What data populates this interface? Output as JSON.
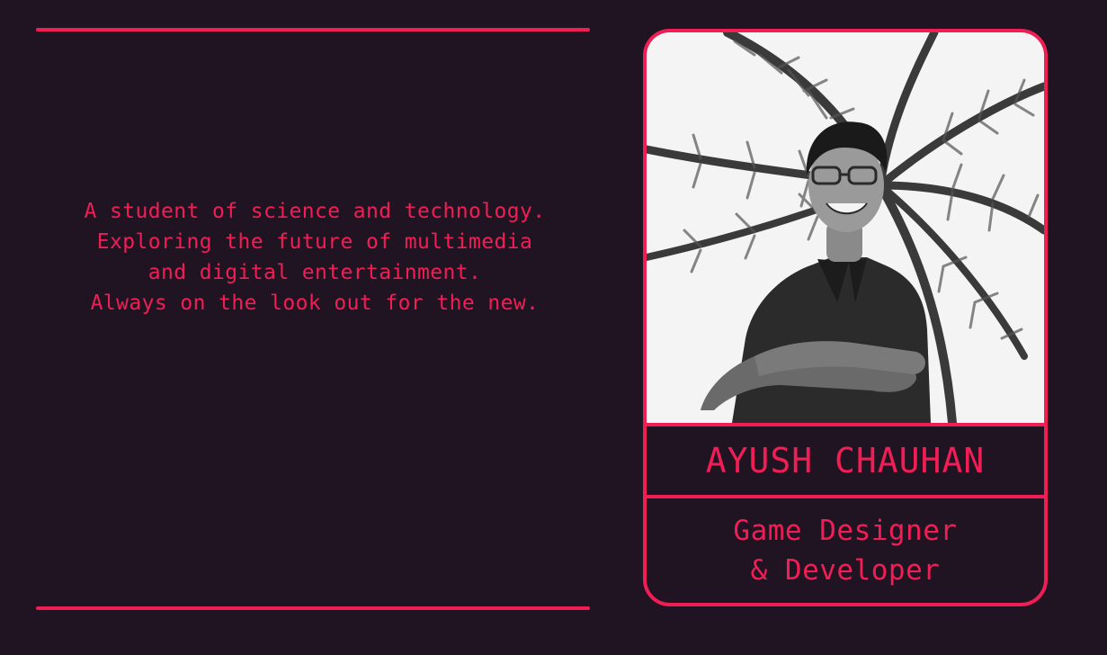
{
  "bio": {
    "lines": [
      "A student of science and technology.",
      "Exploring the future of multimedia",
      "and digital entertainment.",
      "Always on the look out for the new."
    ]
  },
  "profile": {
    "name": "AYUSH CHAUHAN",
    "role_lines": [
      "Game Designer",
      "& Developer"
    ]
  },
  "colors": {
    "background": "#201423",
    "accent": "#f01e55"
  }
}
